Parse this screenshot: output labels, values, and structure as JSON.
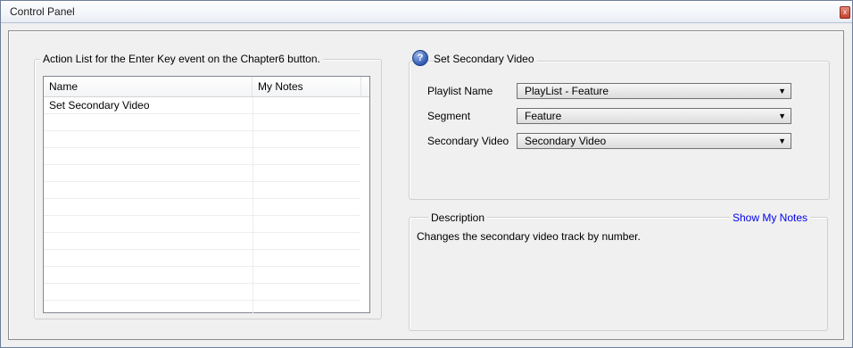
{
  "window": {
    "title": "Control Panel",
    "close_glyph": "x"
  },
  "action_list": {
    "title": "Action List for the Enter Key event on the Chapter6 button.",
    "columns": [
      "Name",
      "My Notes"
    ],
    "rows": [
      {
        "name": "Set Secondary Video",
        "notes": ""
      },
      {
        "name": "",
        "notes": ""
      },
      {
        "name": "",
        "notes": ""
      },
      {
        "name": "",
        "notes": ""
      },
      {
        "name": "",
        "notes": ""
      },
      {
        "name": "",
        "notes": ""
      },
      {
        "name": "",
        "notes": ""
      },
      {
        "name": "",
        "notes": ""
      },
      {
        "name": "",
        "notes": ""
      },
      {
        "name": "",
        "notes": ""
      },
      {
        "name": "",
        "notes": ""
      },
      {
        "name": "",
        "notes": ""
      },
      {
        "name": "",
        "notes": ""
      }
    ]
  },
  "set_secondary": {
    "title": "Set Secondary Video",
    "help_glyph": "?",
    "fields": [
      {
        "label": "Playlist Name",
        "value": "PlayList - Feature"
      },
      {
        "label": "Segment",
        "value": "Feature"
      },
      {
        "label": "Secondary Video",
        "value": "Secondary Video"
      }
    ],
    "dropdown_glyph": "▼"
  },
  "description": {
    "title": "Description",
    "link": "Show My Notes",
    "text": "Changes the secondary video track by number."
  },
  "colors": {
    "link": "#0000ee",
    "window_bg": "#f0f0f0"
  }
}
